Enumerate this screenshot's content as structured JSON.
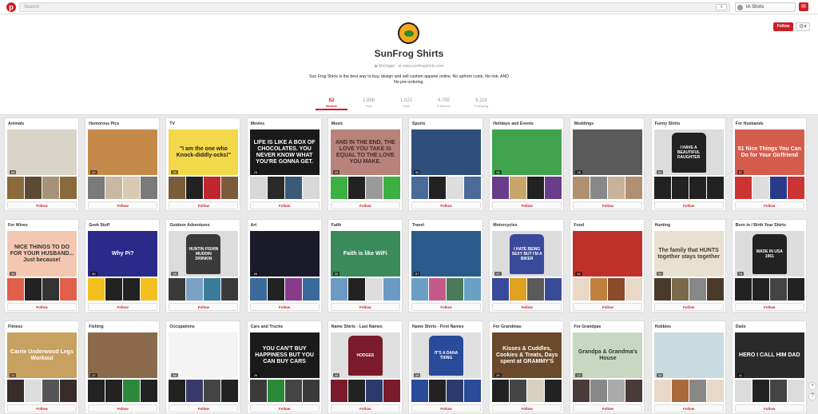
{
  "topbar": {
    "logo": "p",
    "search_placeholder": "Search",
    "user_name": "IA Shirts",
    "menu_icon": "≡"
  },
  "profile": {
    "name": "SunFrog Shirts",
    "location": "Michigan",
    "website": "www.sunfrogshirts.com",
    "about": "Sun Frog Shirts is the best way to buy, design and sell custom apparel online. No upfront costs, No risk, AND No pre-ordering.",
    "follow_label": "Follow",
    "stats": [
      {
        "value": "62",
        "label": "Boards"
      },
      {
        "value": "1,888",
        "label": "Pins"
      },
      {
        "value": "1,022",
        "label": "Likes"
      },
      {
        "value": "4,785",
        "label": "Followers"
      },
      {
        "value": "6,119",
        "label": "Following"
      }
    ]
  },
  "boards": [
    {
      "title": "Animals",
      "pins": "66",
      "cover_text": "",
      "colors": [
        "#d9d4c8",
        "#8a6a3a",
        "#5c4a34",
        "#a69276"
      ],
      "cover_fg": "#333"
    },
    {
      "title": "Humorous Pics",
      "pins": "62",
      "cover_text": "",
      "colors": [
        "#c58a4a",
        "#7a7a7a",
        "#c9b7a1",
        "#d8c9b0"
      ],
      "cover_fg": "#fff"
    },
    {
      "title": "TV",
      "pins": "25",
      "cover_text": "\"I am the one who Knock-diddly-ocks!\"",
      "colors": [
        "#f3d84a",
        "#7a5b3a",
        "#222",
        "#c0262d"
      ],
      "cover_fg": "#222"
    },
    {
      "title": "Movies",
      "pins": "25",
      "cover_text": "LIFE IS LIKE A BOX OF CHOCOLATES. YOU NEVER KNOW WHAT YOU'RE GONNA GET.",
      "colors": [
        "#1a1a1a",
        "#d8d8d8",
        "#2a2a2a",
        "#3a5a7a"
      ],
      "cover_fg": "#fff"
    },
    {
      "title": "Music",
      "pins": "25",
      "cover_text": "AND IN THE END, THE LOVE YOU TAKE IS EQUAL TO THE LOVE YOU MAKE.",
      "colors": [
        "#b7837a",
        "#3cb043",
        "#222",
        "#9a9a9a"
      ],
      "cover_fg": "#4a2a2a"
    },
    {
      "title": "Sports",
      "pins": "50",
      "cover_text": "",
      "colors": [
        "#2f4f7a",
        "#4a6a9a",
        "#222",
        "#ddd"
      ],
      "cover_fg": "#fff"
    },
    {
      "title": "Holidays and Events",
      "pins": "54",
      "cover_text": "",
      "colors": [
        "#3fa34d",
        "#6a3d8a",
        "#c9a56a",
        "#222"
      ],
      "cover_fg": "#fff"
    },
    {
      "title": "Weddings",
      "pins": "26",
      "cover_text": "",
      "colors": [
        "#5a5a5a",
        "#b09070",
        "#888",
        "#c8b29a"
      ],
      "cover_fg": "#fff"
    },
    {
      "title": "Funny Shirts",
      "pins": "60",
      "cover_text": "I HAVE A BEAUTIFUL DAUGHTER",
      "colors": [
        "#dcdcdc",
        "#222",
        "#222",
        "#222"
      ],
      "cover_fg": "#fff",
      "shirt": true
    },
    {
      "title": "For Husbands",
      "pins": "57",
      "cover_text": "51 Nice Things You Can Do for Your Girlfriend",
      "colors": [
        "#d45c4c",
        "#c33",
        "#ddd",
        "#2a3a8a"
      ],
      "cover_fg": "#fff"
    },
    {
      "title": "For Wives",
      "pins": "26",
      "cover_text": "NICE THINGS TO DO FOR YOUR HUSBAND... Just because!",
      "colors": [
        "#f4c7b2",
        "#e0604a",
        "#222",
        "#333"
      ],
      "cover_fg": "#333"
    },
    {
      "title": "Geek Stuff",
      "pins": "80",
      "cover_text": "Why Pi?",
      "colors": [
        "#2a2a8a",
        "#f4c020",
        "#222",
        "#222"
      ],
      "cover_fg": "#fff"
    },
    {
      "title": "Outdoor Adventures",
      "pins": "45",
      "cover_text": "HUNTIN FISHIN MUDDIN DRINKIN",
      "colors": [
        "#dcdcdc",
        "#3a3a3a",
        "#7aa0c4",
        "#3a7a9a"
      ],
      "cover_fg": "#fff",
      "shirt": true
    },
    {
      "title": "Art",
      "pins": "65",
      "cover_text": "",
      "colors": [
        "#1a1a2a",
        "#3a6a9a",
        "#222",
        "#8a3a8a"
      ],
      "cover_fg": "#fff"
    },
    {
      "title": "Faith",
      "pins": "30",
      "cover_text": "Faith is like WiFi",
      "colors": [
        "#3a8a5a",
        "#6a9ac4",
        "#222",
        "#ddd"
      ],
      "cover_fg": "#fff"
    },
    {
      "title": "Travel",
      "pins": "57",
      "cover_text": "",
      "colors": [
        "#2a5a8a",
        "#6aa0c4",
        "#c45a8a",
        "#4a7a5a"
      ],
      "cover_fg": "#fff"
    },
    {
      "title": "Motorcycles",
      "pins": "37",
      "cover_text": "I HATE BEING SEXY BUT I'M A BIKER",
      "colors": [
        "#dcdcdc",
        "#3a4a9a",
        "#e0a020",
        "#5a5a5a"
      ],
      "cover_fg": "#fff",
      "shirt": true
    },
    {
      "title": "Food",
      "pins": "41",
      "cover_text": "",
      "colors": [
        "#c0302a",
        "#e8d8c8",
        "#c08040",
        "#8a4a2a"
      ],
      "cover_fg": "#fff"
    },
    {
      "title": "Hunting",
      "pins": "35",
      "cover_text": "The family that HUNTS together stays together",
      "colors": [
        "#e8e0d0",
        "#4a3a2a",
        "#7a6a4a",
        "#888"
      ],
      "cover_fg": "#4a3a2a"
    },
    {
      "title": "Born in / Birth Year Shirts",
      "pins": "76",
      "cover_text": "MADE IN USA 1961",
      "colors": [
        "#dcdcdc",
        "#222",
        "#222",
        "#444"
      ],
      "cover_fg": "#fff",
      "shirt": true
    },
    {
      "title": "Fitness",
      "pins": "29",
      "cover_text": "Carrie Underwood Legs Workout",
      "colors": [
        "#c8a060",
        "#3a2a2a",
        "#ddd",
        "#555"
      ],
      "cover_fg": "#fff"
    },
    {
      "title": "Fishing",
      "pins": "27",
      "cover_text": "",
      "colors": [
        "#8a6a4a",
        "#222",
        "#222",
        "#2a8a3a"
      ],
      "cover_fg": "#fff"
    },
    {
      "title": "Occupations",
      "pins": "46",
      "cover_text": "",
      "colors": [
        "#f4f4f4",
        "#222",
        "#3a3a6a",
        "#444"
      ],
      "cover_fg": "#222"
    },
    {
      "title": "Cars and Trucks",
      "pins": "26",
      "cover_text": "YOU CAN'T BUY HAPPINESS BUT YOU CAN BUY CARS",
      "colors": [
        "#1a1a1a",
        "#3a3a3a",
        "#2a8a3a",
        "#444"
      ],
      "cover_fg": "#fff"
    },
    {
      "title": "Name Shirts - Last Names",
      "pins": "30",
      "cover_text": "HODGES",
      "colors": [
        "#e0e0e0",
        "#7a1a2a",
        "#222",
        "#2a3a6a"
      ],
      "cover_fg": "#fff",
      "shirt": true
    },
    {
      "title": "Name Shirts - First Names",
      "pins": "35",
      "cover_text": "IT'S A DANA THING",
      "colors": [
        "#e0e0e0",
        "#2a4a9a",
        "#222",
        "#2a3a6a"
      ],
      "cover_fg": "#fff",
      "shirt": true
    },
    {
      "title": "For Grandmas",
      "pins": "29",
      "cover_text": "Kisses & Cuddles, Cookies & Treats, Days spent at GRAMMY'S",
      "colors": [
        "#6a4a2a",
        "#222",
        "#444",
        "#d8d0c0"
      ],
      "cover_fg": "#fff"
    },
    {
      "title": "For Grandpas",
      "pins": "22",
      "cover_text": "Grandpa & Grandma's House",
      "colors": [
        "#c8d8c0",
        "#4a3a3a",
        "#888",
        "#aaa"
      ],
      "cover_fg": "#333"
    },
    {
      "title": "Hobbies",
      "pins": "28",
      "cover_text": "",
      "colors": [
        "#c8dce0",
        "#e8d8c8",
        "#a86a3a",
        "#888"
      ],
      "cover_fg": "#fff"
    },
    {
      "title": "Dads",
      "pins": "11",
      "cover_text": "HERO I CALL HIM DAD",
      "colors": [
        "#2a2a2a",
        "#dcdcdc",
        "#222",
        "#444"
      ],
      "cover_fg": "#fff"
    }
  ],
  "follow_label": "Follow",
  "scroll": {
    "plus": "+",
    "help": "?"
  }
}
